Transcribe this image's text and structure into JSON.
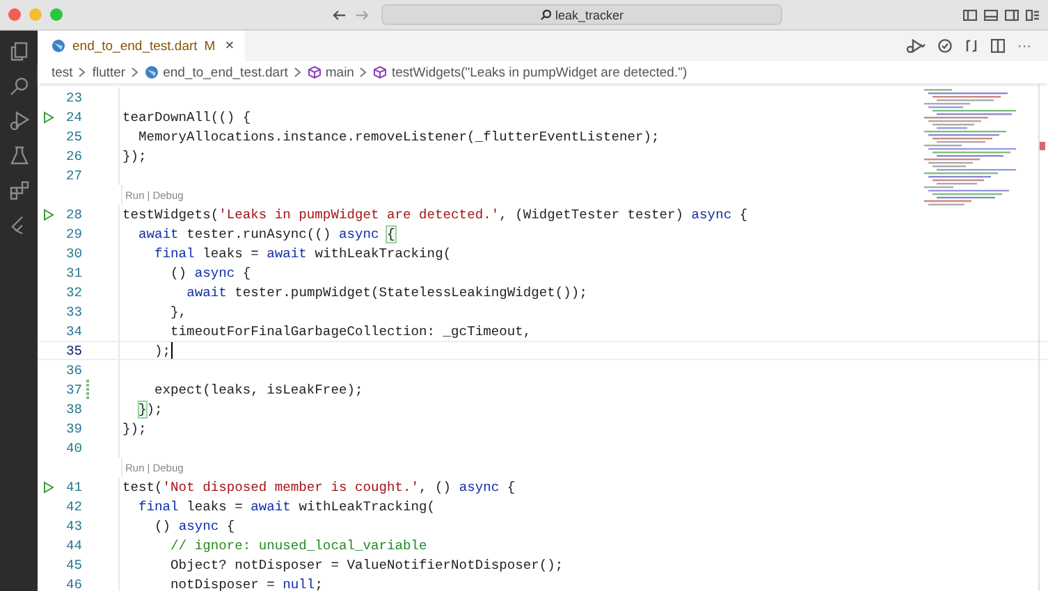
{
  "window": {
    "search": "leak_tracker"
  },
  "tab": {
    "label": "end_to_end_test.dart",
    "status": "M",
    "modified": true,
    "close": "×",
    "selected": true
  },
  "breadcrumb": [
    {
      "kind": "folder",
      "label": "test"
    },
    {
      "kind": "folder",
      "label": "flutter"
    },
    {
      "kind": "file",
      "label": "end_to_end_test.dart"
    },
    {
      "kind": "symbol",
      "label": "main"
    },
    {
      "kind": "symbol",
      "label": "testWidgets(\"Leaks in pumpWidget are detected.\")"
    }
  ],
  "editor": {
    "more": "···",
    "rows": [
      {
        "kind": "code",
        "number": "23"
      },
      {
        "kind": "code",
        "number": "24",
        "run": true,
        "tokens": [
          {
            "kind": "plain",
            "text": "tearDownAll(() {"
          }
        ],
        "children": [
          {
            "kind": "code",
            "number": "25",
            "tokens": [
              {
                "kind": "plain",
                "text": "MemoryAllocations.instance.removeListener(_flutterEventListener);"
              }
            ]
          }
        ]
      },
      {
        "kind": "code",
        "number": "26",
        "tokens": [
          {
            "kind": "plain",
            "text": "});"
          }
        ]
      },
      {
        "kind": "code",
        "number": "27"
      },
      {
        "kind": "codelens",
        "links": [
          "Run",
          "Debug"
        ],
        "separator": "|"
      },
      {
        "kind": "code",
        "number": "28",
        "run": true,
        "tokens": [
          {
            "kind": "plain",
            "text": "testWidgets("
          },
          {
            "kind": "string",
            "text": "'Leaks in pumpWidget are detected.'"
          },
          {
            "kind": "plain",
            "text": ", (WidgetTester tester) "
          },
          {
            "kind": "keyword",
            "text": "async"
          },
          {
            "kind": "plain",
            "text": " {"
          }
        ],
        "children": [
          {
            "kind": "code",
            "number": "29",
            "tokens": [
              {
                "kind": "keyword",
                "text": "await"
              },
              {
                "kind": "plain",
                "text": " tester.runAsync(() "
              },
              {
                "kind": "keyword",
                "text": "async "
              },
              {
                "kind": "match",
                "text": "{"
              }
            ],
            "children": [
              {
                "kind": "code",
                "number": "30",
                "tokens": [
                  {
                    "kind": "keyword",
                    "text": "final"
                  },
                  {
                    "kind": "plain",
                    "text": " leaks = "
                  },
                  {
                    "kind": "keyword",
                    "text": "await"
                  },
                  {
                    "kind": "plain",
                    "text": " withLeakTracking("
                  }
                ],
                "children": [
                  {
                    "kind": "code",
                    "number": "31",
                    "tokens": [
                      {
                        "kind": "plain",
                        "text": "() "
                      },
                      {
                        "kind": "keyword",
                        "text": "async"
                      },
                      {
                        "kind": "plain",
                        "text": " {"
                      }
                    ],
                    "children": [
                      {
                        "kind": "code",
                        "number": "32",
                        "tokens": [
                          {
                            "kind": "keyword",
                            "text": "await"
                          },
                          {
                            "kind": "plain",
                            "text": " tester.pumpWidget(StatelessLeakingWidget());"
                          }
                        ]
                      }
                    ]
                  },
                  {
                    "kind": "code",
                    "number": "33",
                    "tokens": [
                      {
                        "kind": "plain",
                        "text": "},"
                      }
                    ]
                  },
                  {
                    "kind": "code",
                    "number": "34",
                    "tokens": [
                      {
                        "kind": "plain",
                        "text": "timeoutForFinalGarbageCollection: _gcTimeout,"
                      }
                    ]
                  }
                ]
              },
              {
                "kind": "code",
                "number": "35",
                "cursor": true,
                "tokens": [
                  {
                    "kind": "plain",
                    "text": ");"
                  }
                ]
              },
              {
                "kind": "code",
                "number": "36"
              },
              {
                "kind": "code",
                "number": "37",
                "modified": true,
                "tokens": [
                  {
                    "kind": "plain",
                    "text": "expect(leaks, isLeakFree);"
                  }
                ]
              }
            ]
          },
          {
            "kind": "code",
            "number": "38",
            "tokens": [
              {
                "kind": "match",
                "text": "}"
              },
              {
                "kind": "plain",
                "text": ");"
              }
            ]
          }
        ]
      },
      {
        "kind": "code",
        "number": "39",
        "tokens": [
          {
            "kind": "plain",
            "text": "});"
          }
        ]
      },
      {
        "kind": "code",
        "number": "40"
      },
      {
        "kind": "codelens",
        "links": [
          "Run",
          "Debug"
        ],
        "separator": "|"
      },
      {
        "kind": "code",
        "number": "41",
        "run": true,
        "tokens": [
          {
            "kind": "plain",
            "text": "test("
          },
          {
            "kind": "string",
            "text": "'Not disposed member is cought.'"
          },
          {
            "kind": "plain",
            "text": ", () "
          },
          {
            "kind": "keyword",
            "text": "async"
          },
          {
            "kind": "plain",
            "text": " {"
          }
        ],
        "children": [
          {
            "kind": "code",
            "number": "42",
            "tokens": [
              {
                "kind": "keyword",
                "text": "final"
              },
              {
                "kind": "plain",
                "text": " leaks = "
              },
              {
                "kind": "keyword",
                "text": "await"
              },
              {
                "kind": "plain",
                "text": " withLeakTracking("
              }
            ],
            "children": [
              {
                "kind": "code",
                "number": "43",
                "tokens": [
                  {
                    "kind": "plain",
                    "text": "() "
                  },
                  {
                    "kind": "keyword",
                    "text": "async"
                  },
                  {
                    "kind": "plain",
                    "text": " {"
                  }
                ],
                "children": [
                  {
                    "kind": "code",
                    "number": "44",
                    "tokens": [
                      {
                        "kind": "comment",
                        "text": "// ignore: unused_local_variable"
                      }
                    ]
                  },
                  {
                    "kind": "code",
                    "number": "45",
                    "tokens": [
                      {
                        "kind": "plain",
                        "text": "Object? notDisposer = ValueNotifierNotDisposer();"
                      }
                    ]
                  },
                  {
                    "kind": "code",
                    "number": "46",
                    "tokens": [
                      {
                        "kind": "plain",
                        "text": "notDisposer = "
                      },
                      {
                        "kind": "keyword",
                        "text": "null"
                      },
                      {
                        "kind": "plain",
                        "text": ";"
                      }
                    ]
                  }
                ]
              }
            ]
          }
        ]
      }
    ]
  }
}
